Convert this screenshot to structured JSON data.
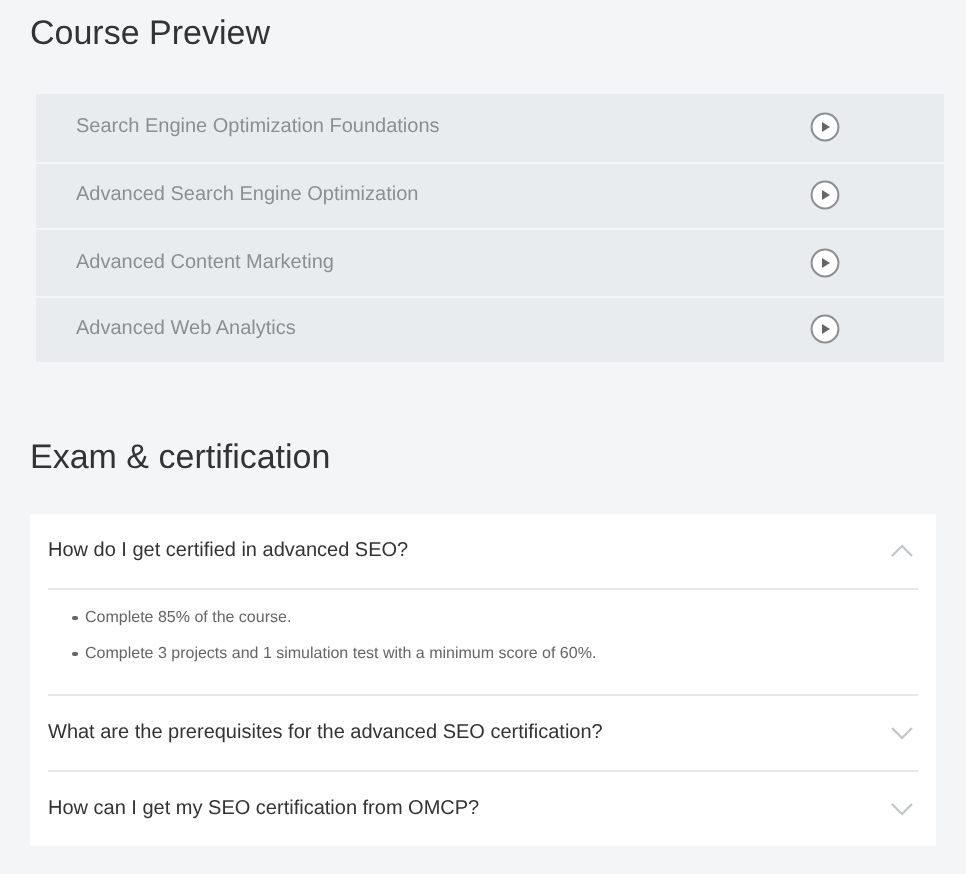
{
  "course_preview": {
    "title": "Course Preview",
    "lessons": [
      {
        "title": "Search Engine Optimization Foundations"
      },
      {
        "title": "Advanced Search Engine Optimization"
      },
      {
        "title": "Advanced Content Marketing"
      },
      {
        "title": "Advanced Web Analytics"
      }
    ]
  },
  "exam": {
    "title": "Exam & certification",
    "faq": [
      {
        "question": "How do I get certified in advanced SEO?",
        "expanded": true,
        "answer": [
          "Complete 85% of the course.",
          "Complete 3 projects and 1 simulation test with a minimum score of 60%."
        ]
      },
      {
        "question": "What are the prerequisites for the advanced SEO certification?",
        "expanded": false
      },
      {
        "question": "How can I get my SEO certification from OMCP?",
        "expanded": false
      }
    ]
  }
}
